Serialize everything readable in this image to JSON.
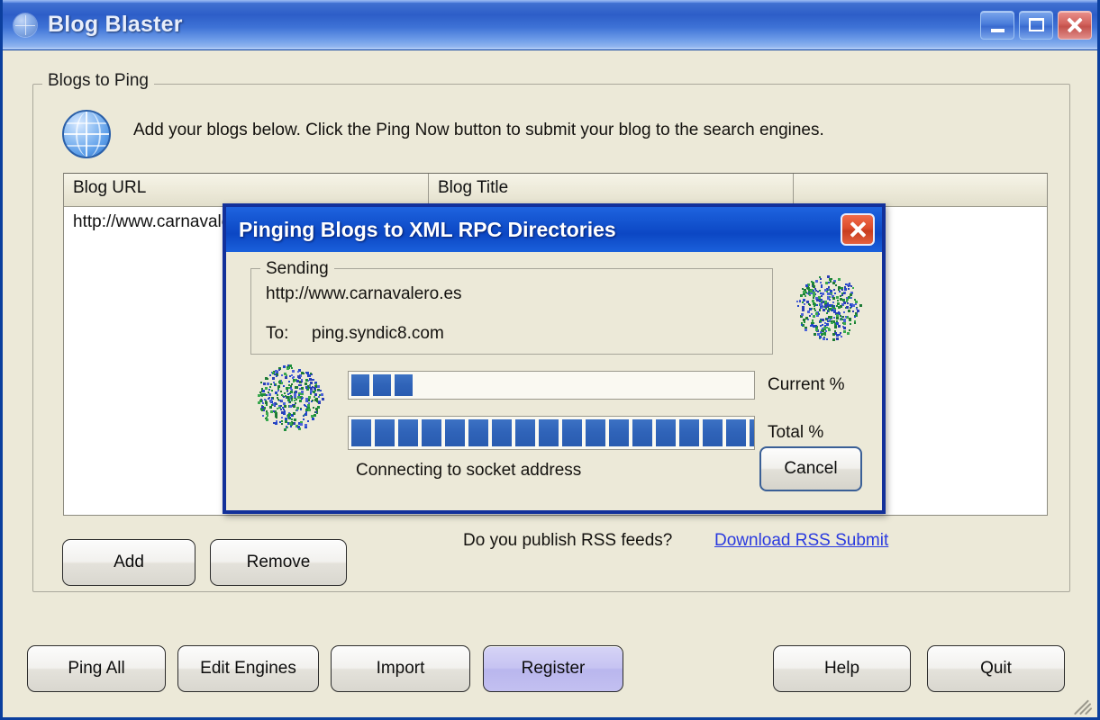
{
  "window": {
    "title": "Blog Blaster",
    "icon": "globe-icon",
    "buttons": {
      "minimize": "minimize",
      "maximize": "maximize",
      "close": "close"
    }
  },
  "panel": {
    "legend": "Blogs to Ping",
    "icon": "globe-icon",
    "instructions": "Add your blogs below. Click the Ping Now button to submit your blog to the search engines."
  },
  "table": {
    "columns": [
      "Blog URL",
      "Blog Title",
      ""
    ],
    "rows": [
      {
        "url": "http://www.carnavalero.es",
        "title": "",
        "extra": ""
      }
    ]
  },
  "panel_buttons": {
    "add": "Add",
    "remove": "Remove"
  },
  "rss": {
    "question": "Do you publish RSS feeds?",
    "link": "Download RSS Submit",
    "link_color": "#2a3adf"
  },
  "bottom_bar": {
    "ping_all": "Ping All",
    "edit_engines": "Edit Engines",
    "import": "Import",
    "register": "Register",
    "register_highlight_color": "#c3c0f0",
    "help": "Help",
    "quit": "Quit"
  },
  "dialog": {
    "title": "Pinging Blogs to XML RPC Directories",
    "close_icon": "close-icon",
    "sending": {
      "legend": "Sending",
      "url": "http://www.carnavalero.es",
      "to_label": "To:",
      "to_value": "ping.syndic8.com"
    },
    "progress": {
      "current_label": "Current %",
      "current_segments": 3,
      "current_total_segments": 18,
      "current_percent": 7,
      "total_label": "Total %",
      "total_segments": 18,
      "total_total_segments": 19,
      "total_percent": 97,
      "bar_color": "#2f63b8"
    },
    "status": "Connecting to socket address",
    "cancel": "Cancel",
    "decor_icon": "speckle-cluster-icon"
  }
}
